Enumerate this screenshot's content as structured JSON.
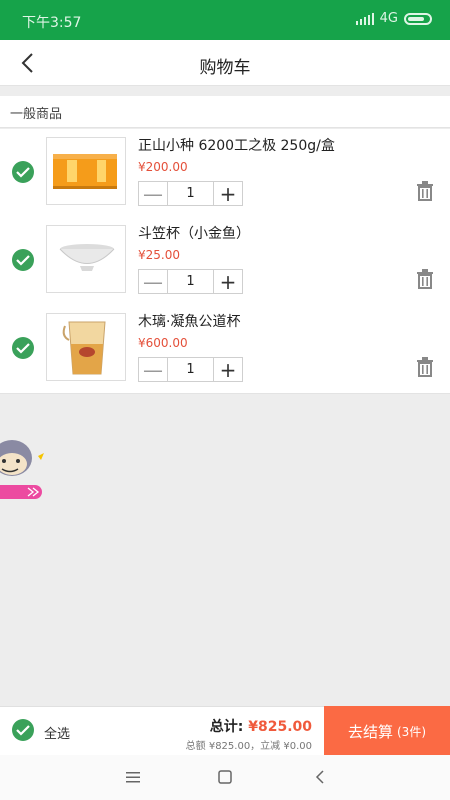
{
  "status_bar": {
    "time": "下午3:57",
    "network": "4G"
  },
  "nav": {
    "title": "购物车"
  },
  "section": {
    "title": "一般商品"
  },
  "items": [
    {
      "name": "正山小种 6200工之极 250g/盒",
      "price": "¥200.00",
      "quantity": "1"
    },
    {
      "name": "斗笠杯（小金鱼）",
      "price": "¥25.00",
      "quantity": "1"
    },
    {
      "name": "木璃·凝魚公道杯",
      "price": "¥600.00",
      "quantity": "1"
    }
  ],
  "footer": {
    "select_all_label": "全选",
    "total_label": "总计:",
    "total_amount": "¥825.00",
    "detail": "总额 ¥825.00，立减 ¥0.00",
    "checkout_label": "去结算",
    "checkout_count": "(3件)"
  },
  "colors": {
    "status_bar": "#16a34a",
    "accent": "#fb6a44",
    "price": "#e4503a",
    "check": "#3aa15a"
  },
  "icons": {
    "back": "chevron-left-icon",
    "check": "check-circle-icon",
    "trash": "trash-icon",
    "menu": "menu-icon",
    "home": "home-square-icon",
    "sys_back": "triangle-back-icon"
  }
}
